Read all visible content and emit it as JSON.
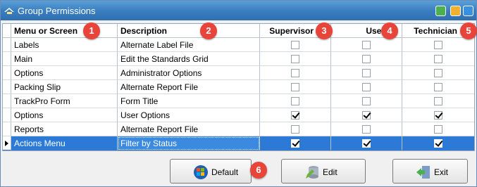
{
  "window": {
    "title": "Group Permissions"
  },
  "columns": {
    "menu": "Menu or Screen",
    "description": "Description",
    "supervisor": "Supervisor",
    "user": "User",
    "technician": "Technician"
  },
  "rows": [
    {
      "menu": "Labels",
      "description": "Alternate Label File",
      "supervisor": false,
      "user": false,
      "technician": false
    },
    {
      "menu": "Main",
      "description": "Edit the Standards Grid",
      "supervisor": false,
      "user": false,
      "technician": false
    },
    {
      "menu": "Options",
      "description": "Administrator Options",
      "supervisor": false,
      "user": false,
      "technician": false
    },
    {
      "menu": "Packing Slip",
      "description": "Alternate Report File",
      "supervisor": false,
      "user": false,
      "technician": false
    },
    {
      "menu": "TrackPro Form",
      "description": "Form Title",
      "supervisor": false,
      "user": false,
      "technician": false
    },
    {
      "menu": "Options",
      "description": "User Options",
      "supervisor": true,
      "user": true,
      "technician": true
    },
    {
      "menu": "Reports",
      "description": "Alternate Report File",
      "supervisor": false,
      "user": false,
      "technician": false
    },
    {
      "menu": "Actions Menu",
      "description": "Filter by Status",
      "supervisor": true,
      "user": true,
      "technician": true,
      "selected": true
    }
  ],
  "badges": [
    "1",
    "2",
    "3",
    "4",
    "5",
    "6"
  ],
  "buttons": {
    "default": "Default",
    "edit": "Edit",
    "exit": "Exit"
  },
  "colors": {
    "titlebar": "#3a7fc1",
    "selection": "#2d7ad6",
    "badge": "#e8443a"
  }
}
